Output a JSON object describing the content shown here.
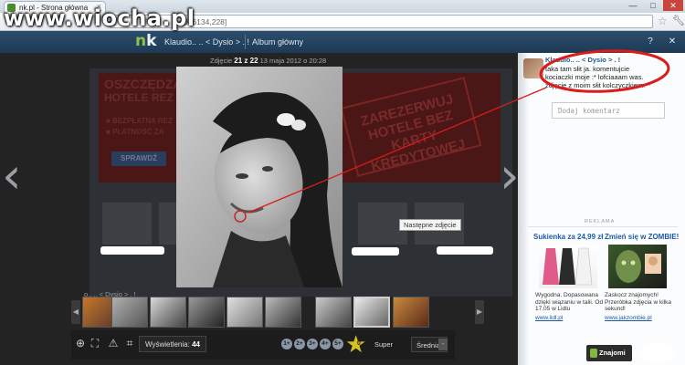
{
  "watermark": "www.wiocha.pl",
  "browser": {
    "tab_title": "nk.pl - Strona główna",
    "tab_close": "×",
    "url_fragment": "086134,228]",
    "minimize": "—",
    "maximize": "□",
    "close": "✕"
  },
  "header": {
    "logo_n": "n",
    "logo_k": "k",
    "crumb_user": "Klaudio.. .. < Dysio > . !",
    "crumb_album": "Album główny",
    "help": "?",
    "close": "✕"
  },
  "viewer": {
    "photo_label": "Zdjęcie",
    "photo_index": "21 z 22",
    "photo_date": "13 maja 2012 o 20:28",
    "next_tooltip": "Następne zdjęcie",
    "prev_arrow": "‹",
    "next_arrow": "›",
    "strip_title": "o.. .. < Dysio > . !",
    "thumb_prev": "◀",
    "thumb_next": "▶"
  },
  "background_ad": {
    "line1": "OSZCZĘDZAJ",
    "line2": "HOTELE REZ",
    "bullet1": "■ BEZPŁATNA REZ",
    "bullet2": "■ PŁATNOŚĆ ZA",
    "button": "SPRAWDŹ",
    "badge": "ZAREZERWUJ HOTELE BEZ KARTY KREDYTOWEJ"
  },
  "bottombar": {
    "views_label": "Wyświetlenia:",
    "views_count": "44",
    "ratings": [
      "1+",
      "2+",
      "3+",
      "4+",
      "5+"
    ],
    "super": "Super",
    "super_count": "0",
    "avg_label": "Średnia:",
    "avg_value": "-"
  },
  "comments": {
    "author": "Klaudio.. .. < Dysio > . !",
    "body": "taka tam słit ja. komentujcie kociaczki moje :* lofciaaam was. zdjęcie z moim słit kolczyczkiem.**",
    "input_placeholder": "Dodaj komentarz"
  },
  "ads": {
    "label": "REKLAMA",
    "left": {
      "title": "Sukienka za 24,99 zł",
      "text": "Wygodna. Dopasowana dzięki wiązaniu w talii. Od 17.05 w Lidlu",
      "link": "www.lidl.pl"
    },
    "right": {
      "title": "Zmień się w ZOMBIE!",
      "text": "Zaskocz znajomych! Przeróbka zdjęcia w kilka sekund!",
      "link": "www.jakzombie.pl"
    }
  },
  "friends_button": "Znajomi"
}
